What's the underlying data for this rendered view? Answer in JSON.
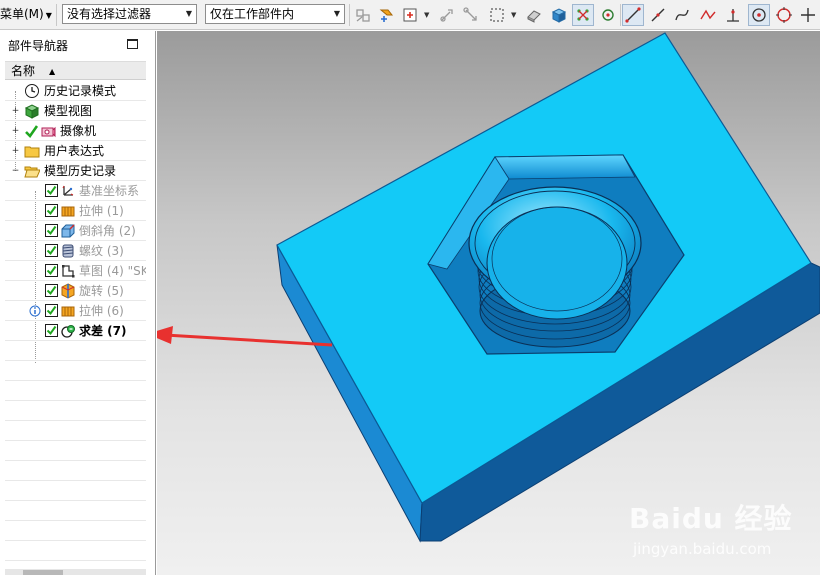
{
  "toolbar": {
    "menu_label": "菜单(M)",
    "filter_select": "没有选择过滤器",
    "scope_select": "仅在工作部件内",
    "icons": [
      "snap-ignore-icon",
      "select-feature-icon",
      "select-box-icon",
      "move-icon",
      "move-handle-icon",
      "rectangle-select-icon",
      "show-hide-icon",
      "view-cube-icon",
      "select-all-icon",
      "fit-icon",
      "line-icon",
      "line-alt-icon",
      "curve-icon",
      "polyline-icon",
      "perpendicular-icon",
      "point-on-circle-icon",
      "circle-icon",
      "plus-icon"
    ]
  },
  "navigator": {
    "title": "部件导航器",
    "column_header": "名称",
    "items": [
      {
        "label": "历史记录模式",
        "icon": "clock-icon"
      },
      {
        "label": "模型视图",
        "icon": "model-view-icon"
      },
      {
        "label": "摄像机",
        "icon": "camera-icon"
      },
      {
        "label": "用户表达式",
        "icon": "folder-icon"
      },
      {
        "label": "模型历史记录",
        "icon": "folder-open-icon"
      }
    ],
    "features": [
      {
        "label": "基准坐标系",
        "icon": "datum-csys-icon"
      },
      {
        "label": "拉伸 (1)",
        "icon": "extrude-icon"
      },
      {
        "label": "倒斜角 (2)",
        "icon": "chamfer-icon"
      },
      {
        "label": "螺纹 (3)",
        "icon": "thread-icon"
      },
      {
        "label": "草图 (4) \"SK",
        "icon": "sketch-icon"
      },
      {
        "label": "旋转 (5)",
        "icon": "revolve-icon"
      },
      {
        "label": "拉伸 (6)",
        "icon": "extrude-icon"
      },
      {
        "label": "求差 (7)",
        "icon": "subtract-icon"
      }
    ]
  },
  "watermark": {
    "brand": "Baidu 经验",
    "url": "jingyan.baidu.com"
  },
  "colors": {
    "part_top": "#13caf7",
    "part_side_left": "#1b8ad3",
    "part_side_front": "#0f5a9a",
    "annotation_arrow": "#e8312f"
  }
}
